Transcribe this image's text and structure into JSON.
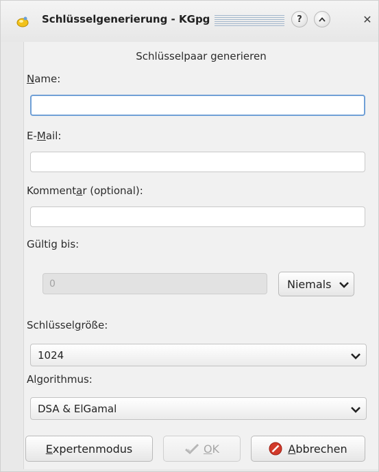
{
  "window": {
    "title": "Schlüsselgenerierung - KGpg",
    "help_button": "?",
    "shade_icon": "chevron-up-icon",
    "close_button": "✕",
    "app_icon": "kgpg-key-icon"
  },
  "form": {
    "section_title": "Schlüsselpaar generieren",
    "name": {
      "label_pre": "",
      "label_accel": "N",
      "label_post": "ame:",
      "value": ""
    },
    "email": {
      "label_pre": "E-",
      "label_accel": "M",
      "label_post": "ail:",
      "value": ""
    },
    "comment": {
      "label_pre": "Komment",
      "label_accel": "a",
      "label_post": "r (optional):",
      "value": ""
    },
    "expiry": {
      "label": "Gültig bis:",
      "value": "0",
      "unit": "Niemals"
    },
    "keysize": {
      "label_pre": "Schlüssel",
      "label_accel": "g",
      "label_post": "röße:",
      "value": "1024"
    },
    "algorithm": {
      "label_pre": "Al",
      "label_accel": "g",
      "label_post": "orithmus:",
      "value": "DSA & ElGamal"
    }
  },
  "buttons": {
    "expert": {
      "accel": "E",
      "rest": "xpertenmodus"
    },
    "ok": {
      "accel": "O",
      "rest": "K",
      "enabled": false
    },
    "cancel": {
      "accel": "A",
      "rest": "bbrechen"
    }
  },
  "colors": {
    "focus_border": "#6f9fd6",
    "cancel_icon": "#d23a2a"
  }
}
